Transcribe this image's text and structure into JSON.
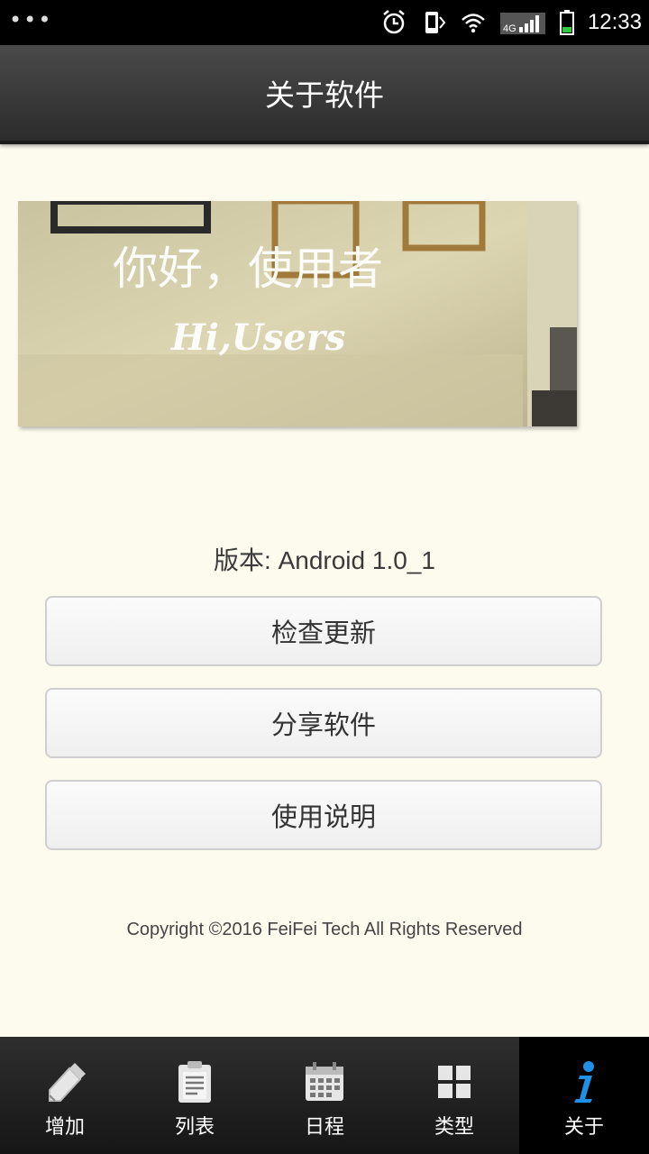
{
  "status_bar": {
    "dots": "•••",
    "network": "4G",
    "time": "12:33"
  },
  "header": {
    "title": "关于软件"
  },
  "banner": {
    "headline": "你好，使用者",
    "subline": "Hi,Users"
  },
  "version_text": "版本: Android 1.0_1",
  "buttons": {
    "check_update": "检查更新",
    "share": "分享软件",
    "instructions": "使用说明"
  },
  "copyright": "Copyright ©2016 FeiFei Tech All Rights Reserved",
  "tabs": [
    {
      "label": "增加",
      "icon": "pencil-icon"
    },
    {
      "label": "列表",
      "icon": "clipboard-icon"
    },
    {
      "label": "日程",
      "icon": "calendar-icon"
    },
    {
      "label": "类型",
      "icon": "grid-icon"
    },
    {
      "label": "关于",
      "icon": "info-icon",
      "active": true
    }
  ],
  "colors": {
    "background": "#fdfaee",
    "title_bar": "#3a3a3a",
    "tab_bar": "#222222",
    "active_icon": "#1e90e6"
  }
}
